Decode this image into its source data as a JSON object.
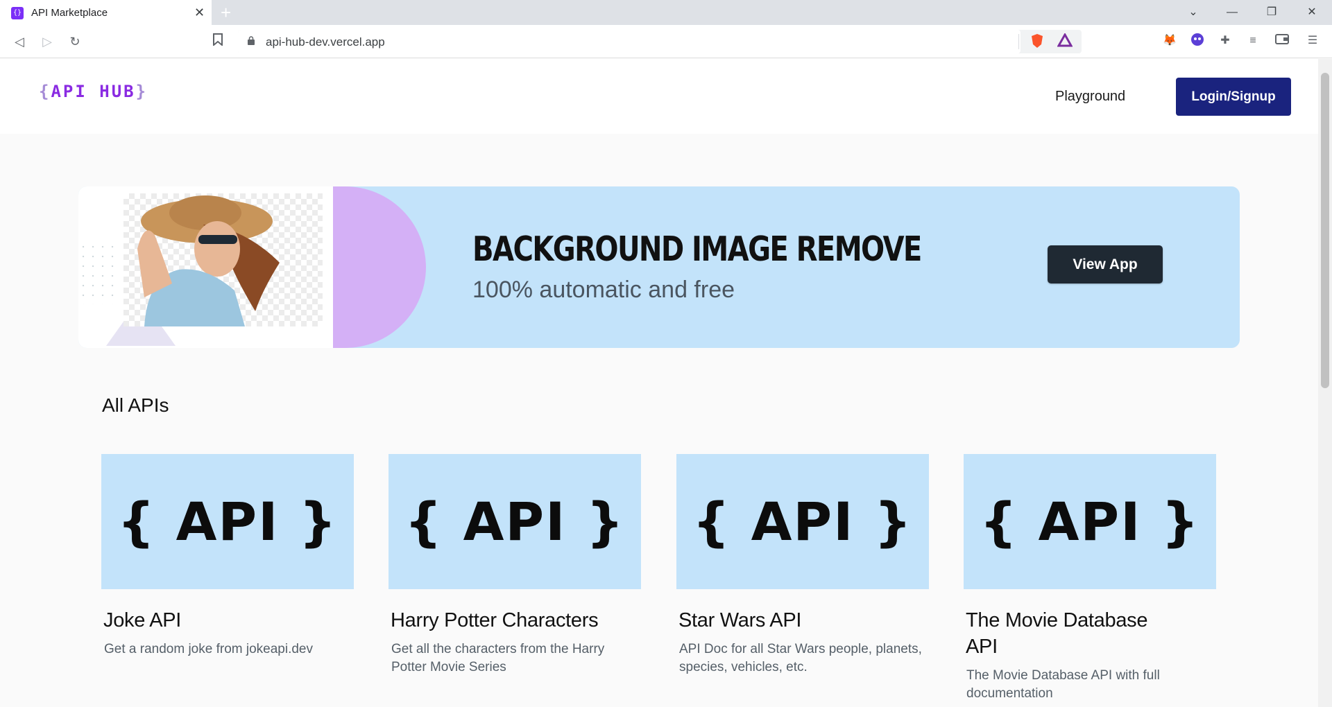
{
  "browser": {
    "tab_title": "API Marketplace",
    "tab_favicon": "{}",
    "url": "api-hub-dev.vercel.app"
  },
  "header": {
    "logo_open": "{",
    "logo_word": "API HUB",
    "logo_close": "}",
    "nav_playground": "Playground",
    "login_label": "Login/Signup"
  },
  "banner": {
    "title": "BACKGROUND IMAGE REMOVE",
    "subtitle": "100% automatic and free",
    "button_label": "View App"
  },
  "section_title": "All APIs",
  "cards": [
    {
      "image_text": "{ API }",
      "title": "Joke API",
      "description": "Get a random joke from jokeapi.dev"
    },
    {
      "image_text": "{ API }",
      "title": "Harry Potter Characters",
      "description": "Get all the characters from the Harry Potter Movie Series"
    },
    {
      "image_text": "{ API }",
      "title": "Star Wars API",
      "description": "API Doc for all Star Wars people, planets, species, vehicles, etc."
    },
    {
      "image_text": "{ API }",
      "title": "The Movie Database API",
      "description": "The Movie Database API with full documentation"
    }
  ],
  "colors": {
    "brand_purple": "#8a2be2",
    "login_button": "#1a237e",
    "banner_bg": "#c3e3fa",
    "view_button": "#1f2933"
  }
}
